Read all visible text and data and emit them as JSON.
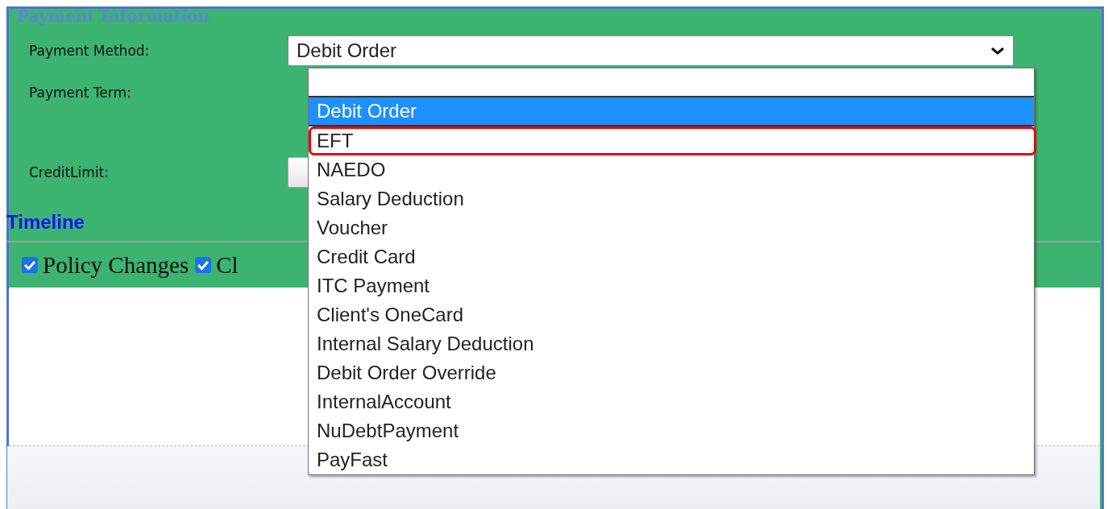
{
  "section": {
    "title": "Payment Information"
  },
  "fields": [
    {
      "label": "Payment Method:",
      "kind": "select",
      "value": "Debit Order"
    },
    {
      "label": "Payment Term:",
      "kind": "blank"
    },
    {
      "label": "CreditLimit:",
      "kind": "input"
    }
  ],
  "payment_method_options": [
    {
      "label": "Debit Order",
      "selected": true,
      "annotated": false
    },
    {
      "label": "EFT",
      "selected": false,
      "annotated": true
    },
    {
      "label": "NAEDO",
      "selected": false,
      "annotated": false
    },
    {
      "label": "Salary Deduction",
      "selected": false,
      "annotated": false
    },
    {
      "label": "Voucher",
      "selected": false,
      "annotated": false
    },
    {
      "label": "Credit Card",
      "selected": false,
      "annotated": false
    },
    {
      "label": "ITC Payment",
      "selected": false,
      "annotated": false
    },
    {
      "label": "Client's OneCard",
      "selected": false,
      "annotated": false
    },
    {
      "label": "Internal Salary Deduction",
      "selected": false,
      "annotated": false
    },
    {
      "label": "Debit Order Override",
      "selected": false,
      "annotated": false
    },
    {
      "label": "InternalAccount",
      "selected": false,
      "annotated": false
    },
    {
      "label": "NuDebtPayment",
      "selected": false,
      "annotated": false
    },
    {
      "label": "PayFast",
      "selected": false,
      "annotated": false
    }
  ],
  "timeline": {
    "title": "Timeline",
    "filters": [
      {
        "label": "Policy Changes",
        "checked": true
      },
      {
        "label": "Cl",
        "checked": true
      }
    ]
  }
}
